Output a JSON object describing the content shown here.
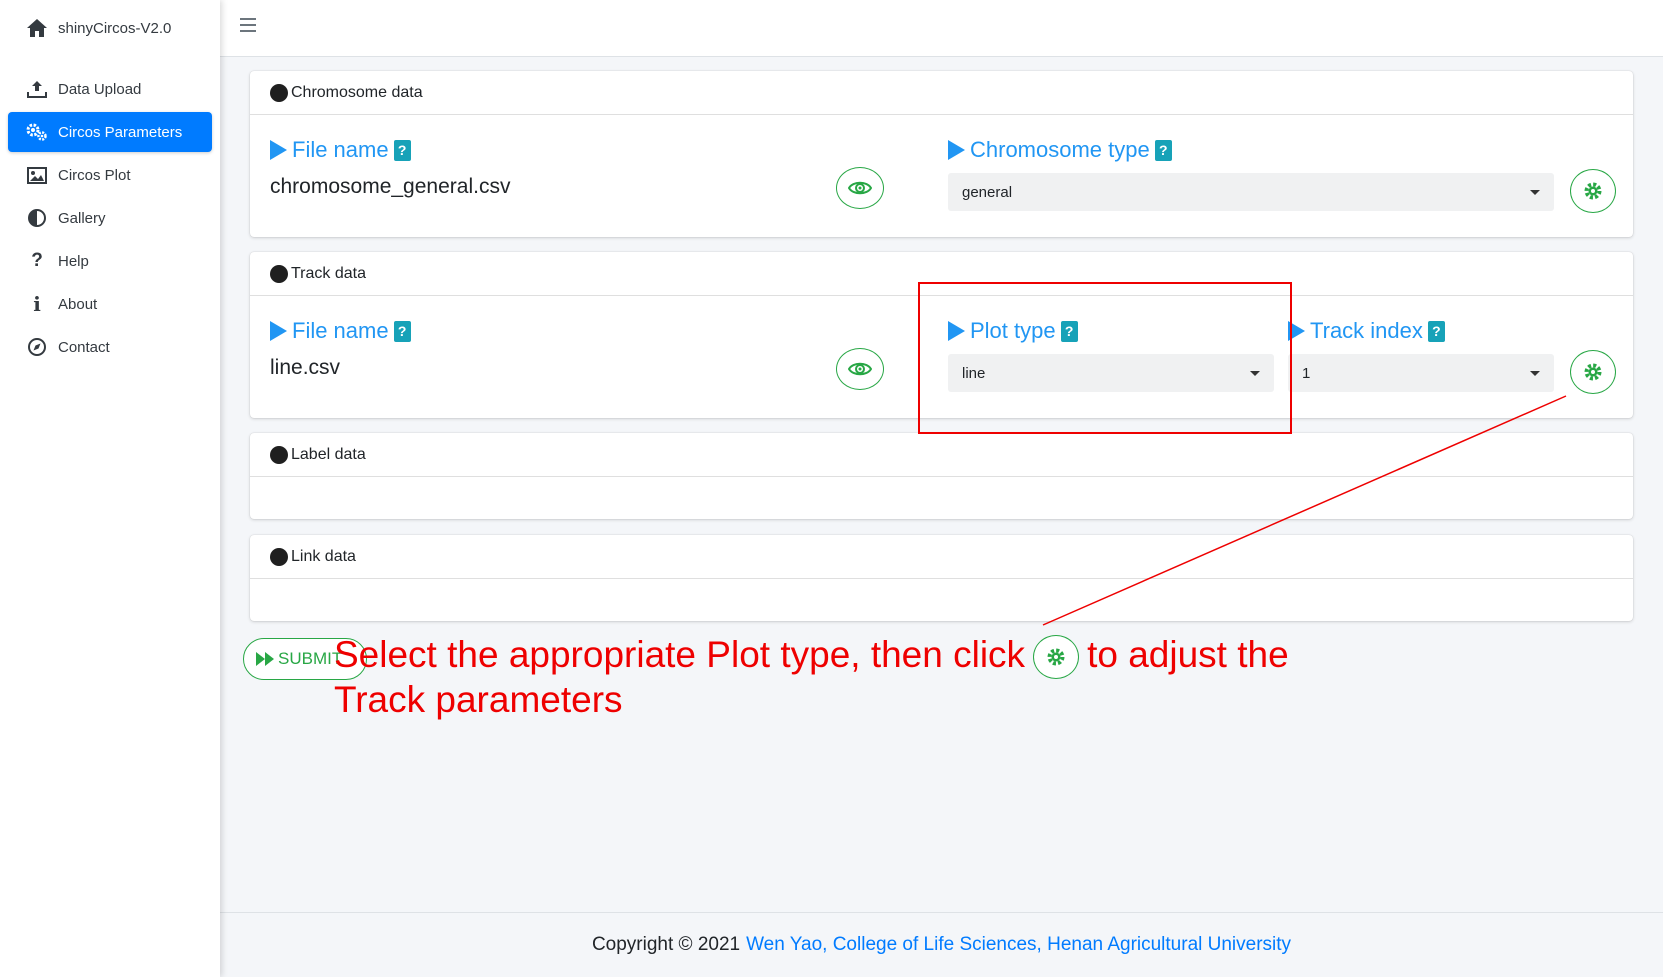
{
  "brand": {
    "title": "shinyCircos-V2.0",
    "icon": "home-icon"
  },
  "sidebar": {
    "items": [
      {
        "label": "Data Upload",
        "icon": "upload-icon",
        "active": false
      },
      {
        "label": "Circos Parameters",
        "icon": "gears-icon",
        "active": true
      },
      {
        "label": "Circos Plot",
        "icon": "image-icon",
        "active": false
      },
      {
        "label": "Gallery",
        "icon": "adjust-icon",
        "active": false
      },
      {
        "label": "Help",
        "icon": "question-icon",
        "active": false
      },
      {
        "label": "About",
        "icon": "info-icon",
        "active": false
      },
      {
        "label": "Contact",
        "icon": "compass-icon",
        "active": false
      }
    ]
  },
  "chromosome": {
    "header": "Chromosome data",
    "file_label": "File name",
    "file_value": "chromosome_general.csv",
    "type_label": "Chromosome type",
    "type_value": "general",
    "help": "?"
  },
  "track": {
    "header": "Track data",
    "file_label": "File name",
    "file_value": "line.csv",
    "plot_label": "Plot type",
    "plot_value": "line",
    "index_label": "Track index",
    "index_value": "1",
    "help": "?"
  },
  "label_data": {
    "header": "Label data"
  },
  "link_data": {
    "header": "Link data"
  },
  "submit": {
    "label": "SUBMIT"
  },
  "annotation": {
    "line1_before": "Select the appropriate Plot type, then click",
    "line1_after": "to adjust the",
    "line2": "Track parameters",
    "color": "#e00000"
  },
  "footer": {
    "prefix": "Copyright © 2021",
    "link": "Wen Yao, College of Life Sciences, Henan Agricultural University"
  },
  "colors": {
    "primary": "#007bff",
    "label_blue": "#2196f3",
    "success": "#28a745",
    "info": "#17a2b8"
  }
}
